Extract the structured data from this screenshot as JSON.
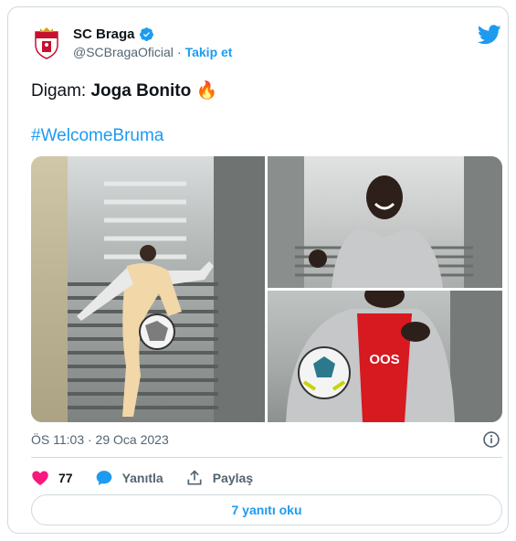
{
  "tweet": {
    "display_name": "SC Braga",
    "handle": "@SCBragaOficial",
    "separator": "·",
    "follow_label": "Takip et",
    "text_prefix": "Digam: ",
    "text_bold": "Joga Bonito",
    "text_emoji": "🔥",
    "hashtag": "#WelcomeBruma",
    "timestamp": "ÖS 11:03 · 29 Oca 2023"
  },
  "actions": {
    "like_count": "77",
    "reply_label": "Yanıtla",
    "share_label": "Paylaş"
  },
  "replies_button": "7 yanıtı oku",
  "icons": [
    "twitter-bird-icon",
    "verified-badge-icon",
    "info-icon",
    "heart-icon",
    "reply-bubble-icon",
    "share-icon"
  ],
  "colors": {
    "accent": "#1d9bf0",
    "like": "#f91880",
    "text": "#0f1419",
    "secondary": "#536471",
    "border": "#cfd9de"
  }
}
